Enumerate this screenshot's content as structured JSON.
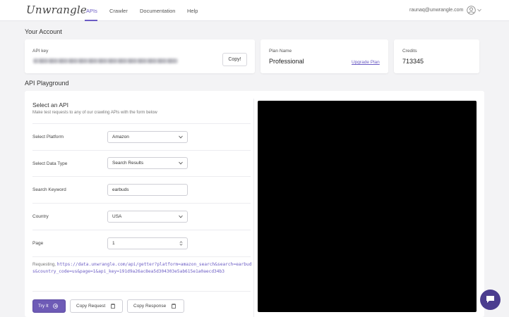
{
  "brand": {
    "logo": "Unwrangle"
  },
  "nav": {
    "items": [
      {
        "label": "APIs",
        "active": true
      },
      {
        "label": "Crawler"
      },
      {
        "label": "Documentation"
      },
      {
        "label": "Help"
      }
    ]
  },
  "user": {
    "email": "raunaq@unwrangle.com"
  },
  "account": {
    "title": "Your Account",
    "api_key_label": "API key",
    "copy_label": "Copy!",
    "plan_label": "Plan Name",
    "plan_value": "Professional",
    "upgrade_label": "Upgrade Plan",
    "credits_label": "Credits",
    "credits_value": "713345"
  },
  "playground": {
    "title": "API Playground",
    "select_title": "Select an API",
    "select_desc": "Make test requests to any of our crawling APIs with the form below",
    "fields": [
      {
        "label": "Select Platform",
        "value": "Amazon",
        "type": "select"
      },
      {
        "label": "Select Data Type",
        "value": "Search Results",
        "type": "select"
      },
      {
        "label": "Search Keyword",
        "value": "earbuds",
        "type": "text"
      },
      {
        "label": "Country",
        "value": "USA",
        "type": "select"
      },
      {
        "label": "Page",
        "value": "1",
        "type": "number"
      }
    ],
    "requesting_label": "Requesting,",
    "request_url": "https://data.unwrangle.com/api/getter?platform=amazon_search&search=earbuds&country_code=us&page=1&api_key=191d9a26ac8ea5d304303e5ab615e1a0aecd34b3",
    "try_label": "Try It",
    "copy_request_label": "Copy Request",
    "copy_response_label": "Copy Response"
  },
  "colors": {
    "accent": "#6b5cc4",
    "primary_button": "#6e5bb6",
    "chat": "#4b3d8f",
    "result_bg": "#000000"
  }
}
